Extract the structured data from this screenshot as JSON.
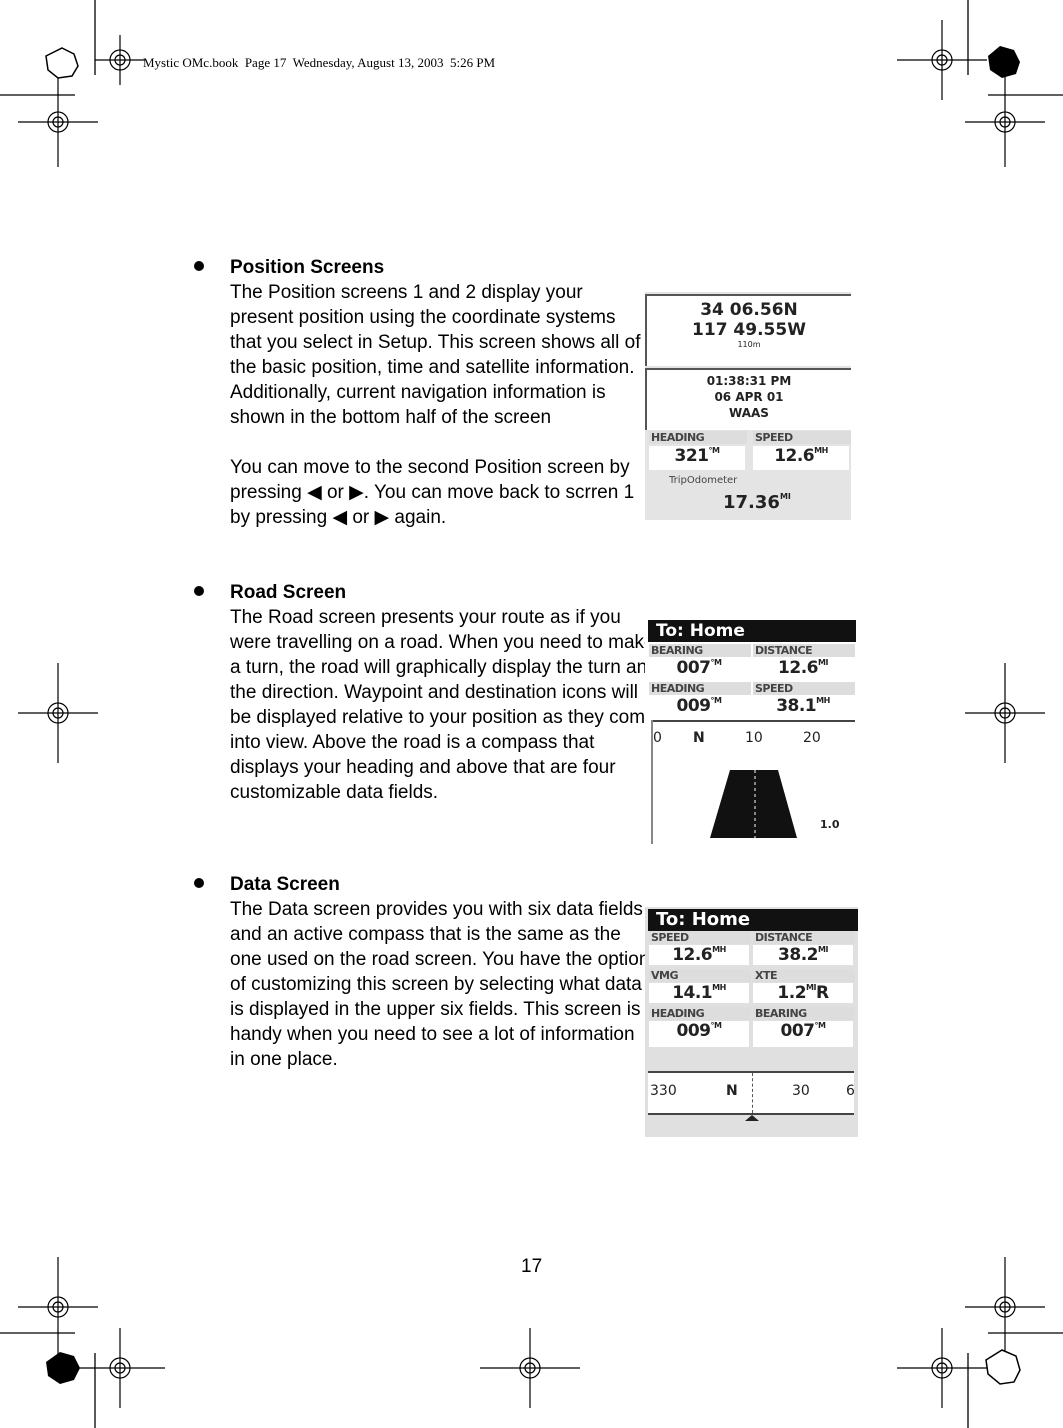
{
  "header": {
    "text": "Mystic OMc.book  Page 17  Wednesday, August 13, 2003  5:26 PM"
  },
  "sections": [
    {
      "title": "Position Screens",
      "paragraphs": [
        "The Position screens 1 and 2 display your present position using the coordinate systems that you select in Setup. This screen shows all of the basic position, time and satellite information. Additionally, current navigation information is shown in the bottom half of the screen",
        "You can move to the second Position screen by pressing ◀ or ▶. You can move back to scrren 1 by pressing ◀ or ▶ again."
      ]
    },
    {
      "title": "Road Screen",
      "paragraphs": [
        "The Road screen presents your route as if you were travelling on a road. When you need to make a turn, the road will graphically display the turn and the direction. Waypoint and destination icons will be displayed relative to your position as they come into view. Above the road is a compass that displays your heading and above that are four customizable data fields."
      ]
    },
    {
      "title": "Data Screen",
      "paragraphs": [
        "The Data screen provides you with six data fields and an active compass that is the same as the one used on the road screen. You have the option of customizing this screen by selecting what data is displayed in the upper six fields. This screen is handy when you need to see a lot of information in one place."
      ]
    }
  ],
  "position_screen": {
    "lat": "34  06.56N",
    "lon": "117  49.55W",
    "altitude": "110m",
    "time": "01:38:31 PM",
    "date": "06 APR 01",
    "fix": "WAAS",
    "heading_label": "HEADING",
    "heading_value": "321",
    "heading_unit": "°M",
    "speed_label": "SPEED",
    "speed_value": "12.6",
    "speed_unit": "MH",
    "odo_label": "TripOdometer",
    "odo_value": "17.36",
    "odo_unit": "MI"
  },
  "road_screen": {
    "title": "To: Home",
    "bearing_label": "BEARING",
    "bearing_value": "007",
    "bearing_unit": "°M",
    "distance_label": "DISTANCE",
    "distance_value": "12.6",
    "distance_unit": "MI",
    "heading_label": "HEADING",
    "heading_value": "009",
    "heading_unit": "°M",
    "speed_label": "SPEED",
    "speed_value": "38.1",
    "speed_unit": "MH",
    "compass": [
      "0",
      "N",
      "10",
      "20"
    ],
    "scale": "1.0"
  },
  "data_screen": {
    "title": "To:  Home",
    "speed_label": "SPEED",
    "speed_value": "12.6",
    "speed_unit": "MH",
    "distance_label": "DISTANCE",
    "distance_value": "38.2",
    "distance_unit": "MI",
    "vmg_label": "VMG",
    "vmg_value": "14.1",
    "vmg_unit": "MH",
    "xte_label": "XTE",
    "xte_value": "1.2",
    "xte_unit": "MI",
    "xte_dir": "R",
    "heading_label": "HEADING",
    "heading_value": "009",
    "heading_unit": "°M",
    "bearing_label": "BEARING",
    "bearing_value": "007",
    "bearing_unit": "°M",
    "compass": [
      "330",
      "N",
      "30",
      "6"
    ]
  },
  "page_number": "17"
}
